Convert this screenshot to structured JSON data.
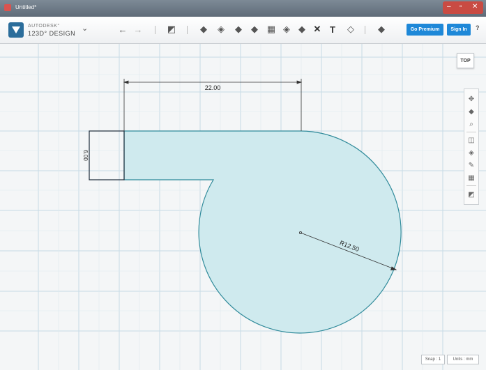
{
  "window": {
    "title": "Untitled*"
  },
  "brand": {
    "line1": "AUTODESK°",
    "line2": "123D° DESIGN"
  },
  "header": {
    "premium_label": "Go Premium",
    "signin_label": "Sign In",
    "help_label": "?"
  },
  "viewcube": {
    "label": "TOP"
  },
  "dimensions": {
    "width": "22.00",
    "height": "6.00",
    "radius": "R12.50"
  },
  "status": {
    "snap": "Snap : 1",
    "units": "Units : mm"
  },
  "colors": {
    "shape_fill": "#cfeaee",
    "shape_stroke": "#2f8a9a",
    "grid": "#b8d4e2",
    "accent": "#1e88d8"
  },
  "icons": [
    "undo-icon",
    "redo-icon",
    "primitives-icon",
    "sketch-icon",
    "construct-icon",
    "modify-icon",
    "pattern-icon",
    "grouping-icon",
    "combine-icon",
    "measure-icon",
    "text-icon",
    "snap-icon",
    "material-icon"
  ]
}
